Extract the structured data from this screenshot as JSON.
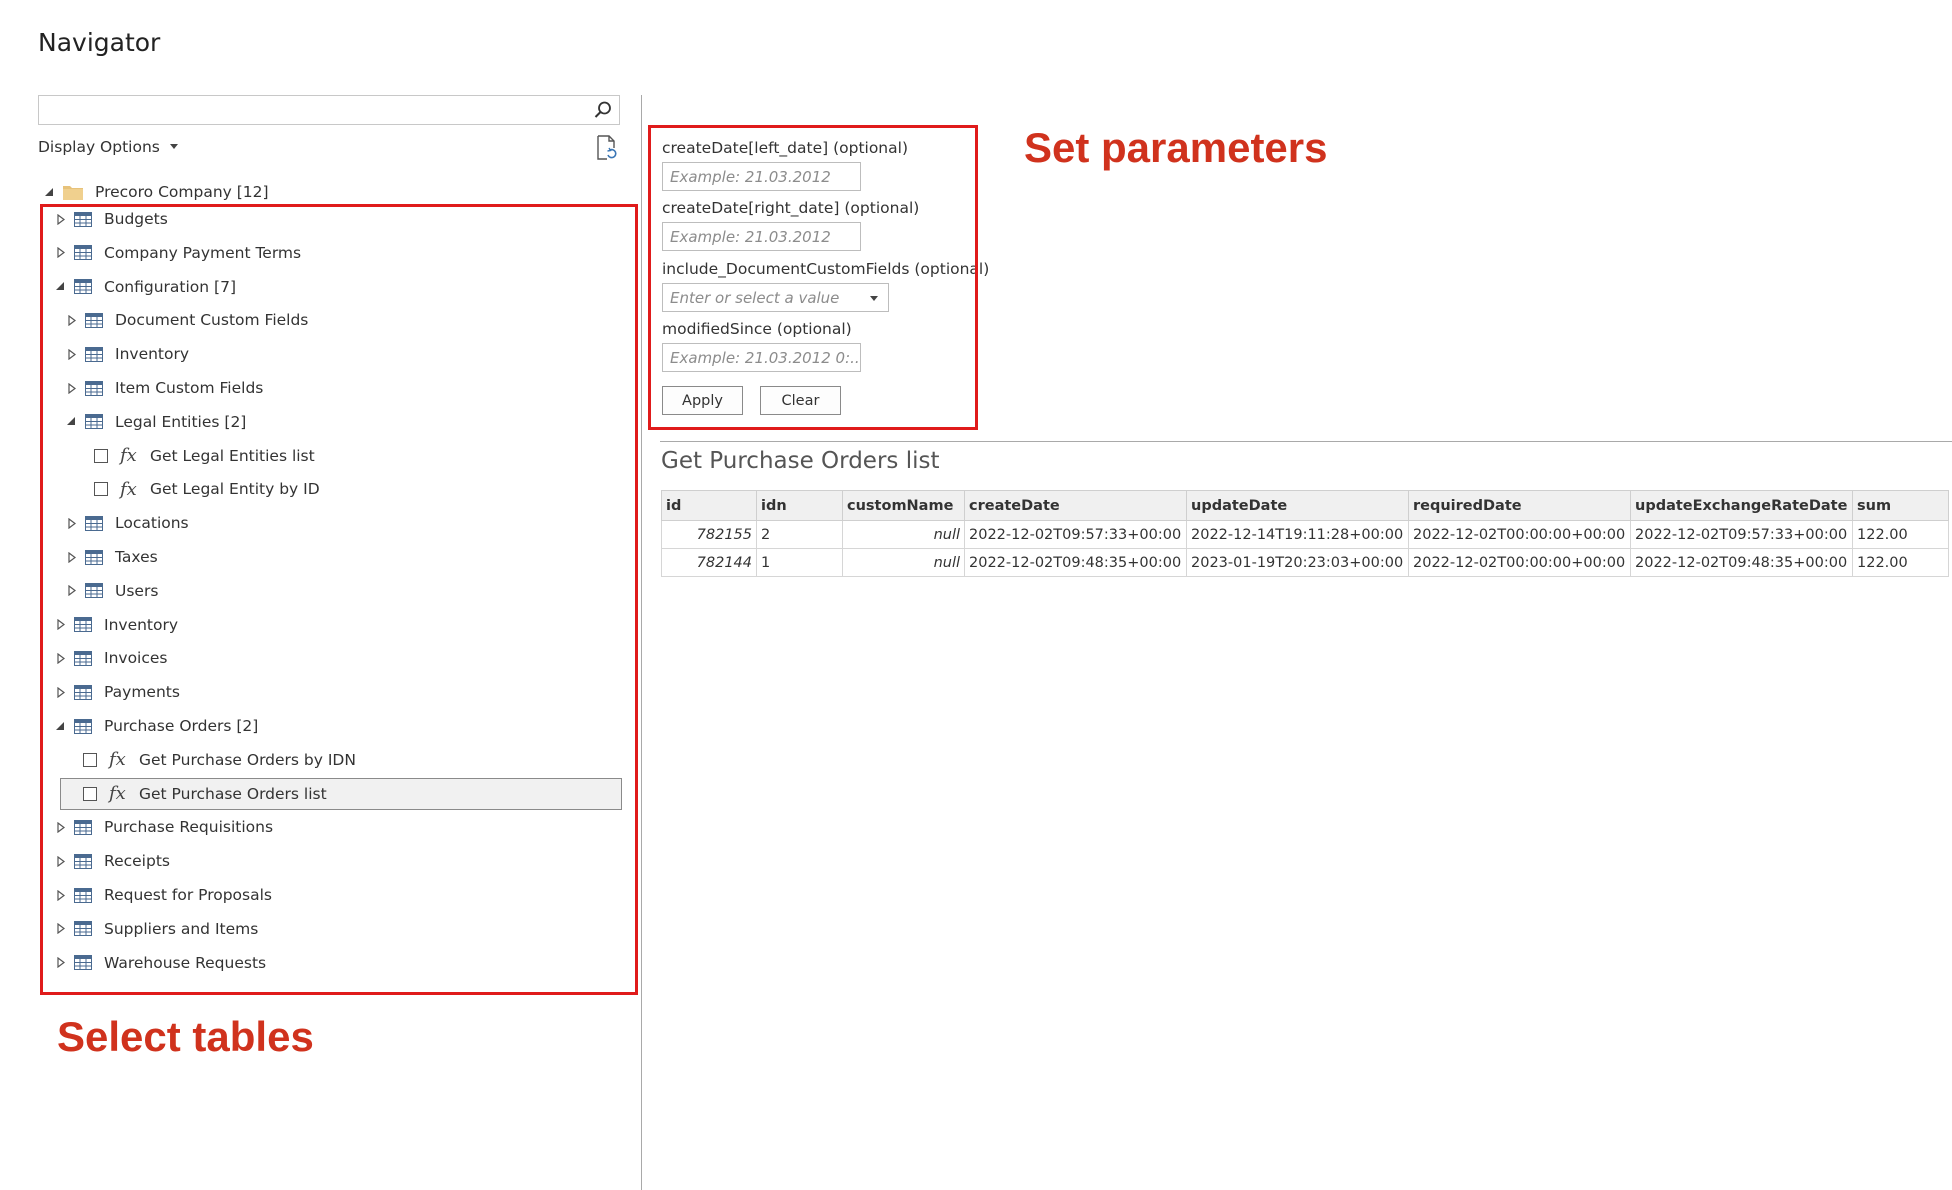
{
  "window": {
    "title": "Navigator"
  },
  "search": {
    "value": "",
    "placeholder": ""
  },
  "display_options": {
    "label": "Display Options"
  },
  "tree": {
    "root": {
      "label": "Precoro Company [12]"
    },
    "items": [
      {
        "label": "Budgets"
      },
      {
        "label": "Company Payment Terms"
      },
      {
        "label": "Configuration [7]"
      },
      {
        "label": "Document Custom Fields"
      },
      {
        "label": "Inventory"
      },
      {
        "label": "Item Custom Fields"
      },
      {
        "label": "Legal Entities [2]"
      },
      {
        "label": "Get Legal Entities list"
      },
      {
        "label": "Get Legal Entity by ID"
      },
      {
        "label": "Locations"
      },
      {
        "label": "Taxes"
      },
      {
        "label": "Users"
      },
      {
        "label": "Inventory"
      },
      {
        "label": "Invoices"
      },
      {
        "label": "Payments"
      },
      {
        "label": "Purchase Orders [2]"
      },
      {
        "label": "Get Purchase Orders by IDN"
      },
      {
        "label": "Get Purchase Orders list"
      },
      {
        "label": "Purchase Requisitions"
      },
      {
        "label": "Receipts"
      },
      {
        "label": "Request for Proposals"
      },
      {
        "label": "Suppliers and Items"
      },
      {
        "label": "Warehouse Requests"
      }
    ]
  },
  "params": {
    "fields": [
      {
        "label": "createDate[left_date] (optional)",
        "placeholder": "Example: 21.03.2012"
      },
      {
        "label": "createDate[right_date] (optional)",
        "placeholder": "Example: 21.03.2012"
      },
      {
        "label": "include_DocumentCustomFields (optional)",
        "placeholder": "Enter or select a value"
      },
      {
        "label": "modifiedSince (optional)",
        "placeholder": "Example: 21.03.2012 0:..."
      }
    ],
    "apply_label": "Apply",
    "clear_label": "Clear"
  },
  "preview": {
    "title": "Get Purchase Orders list",
    "columns": [
      "id",
      "idn",
      "customName",
      "createDate",
      "updateDate",
      "requiredDate",
      "updateExchangeRateDate",
      "sum"
    ],
    "rows": [
      [
        "782155",
        "2",
        "null",
        "2022-12-02T09:57:33+00:00",
        "2022-12-14T19:11:28+00:00",
        "2022-12-02T00:00:00+00:00",
        "2022-12-02T09:57:33+00:00",
        "122.00"
      ],
      [
        "782144",
        "1",
        "null",
        "2022-12-02T09:48:35+00:00",
        "2023-01-19T20:23:03+00:00",
        "2022-12-02T00:00:00+00:00",
        "2022-12-02T09:48:35+00:00",
        "122.00"
      ]
    ]
  },
  "annotations": {
    "set_parameters": "Set parameters",
    "select_tables": "Select tables",
    "color": "#d0321d"
  }
}
